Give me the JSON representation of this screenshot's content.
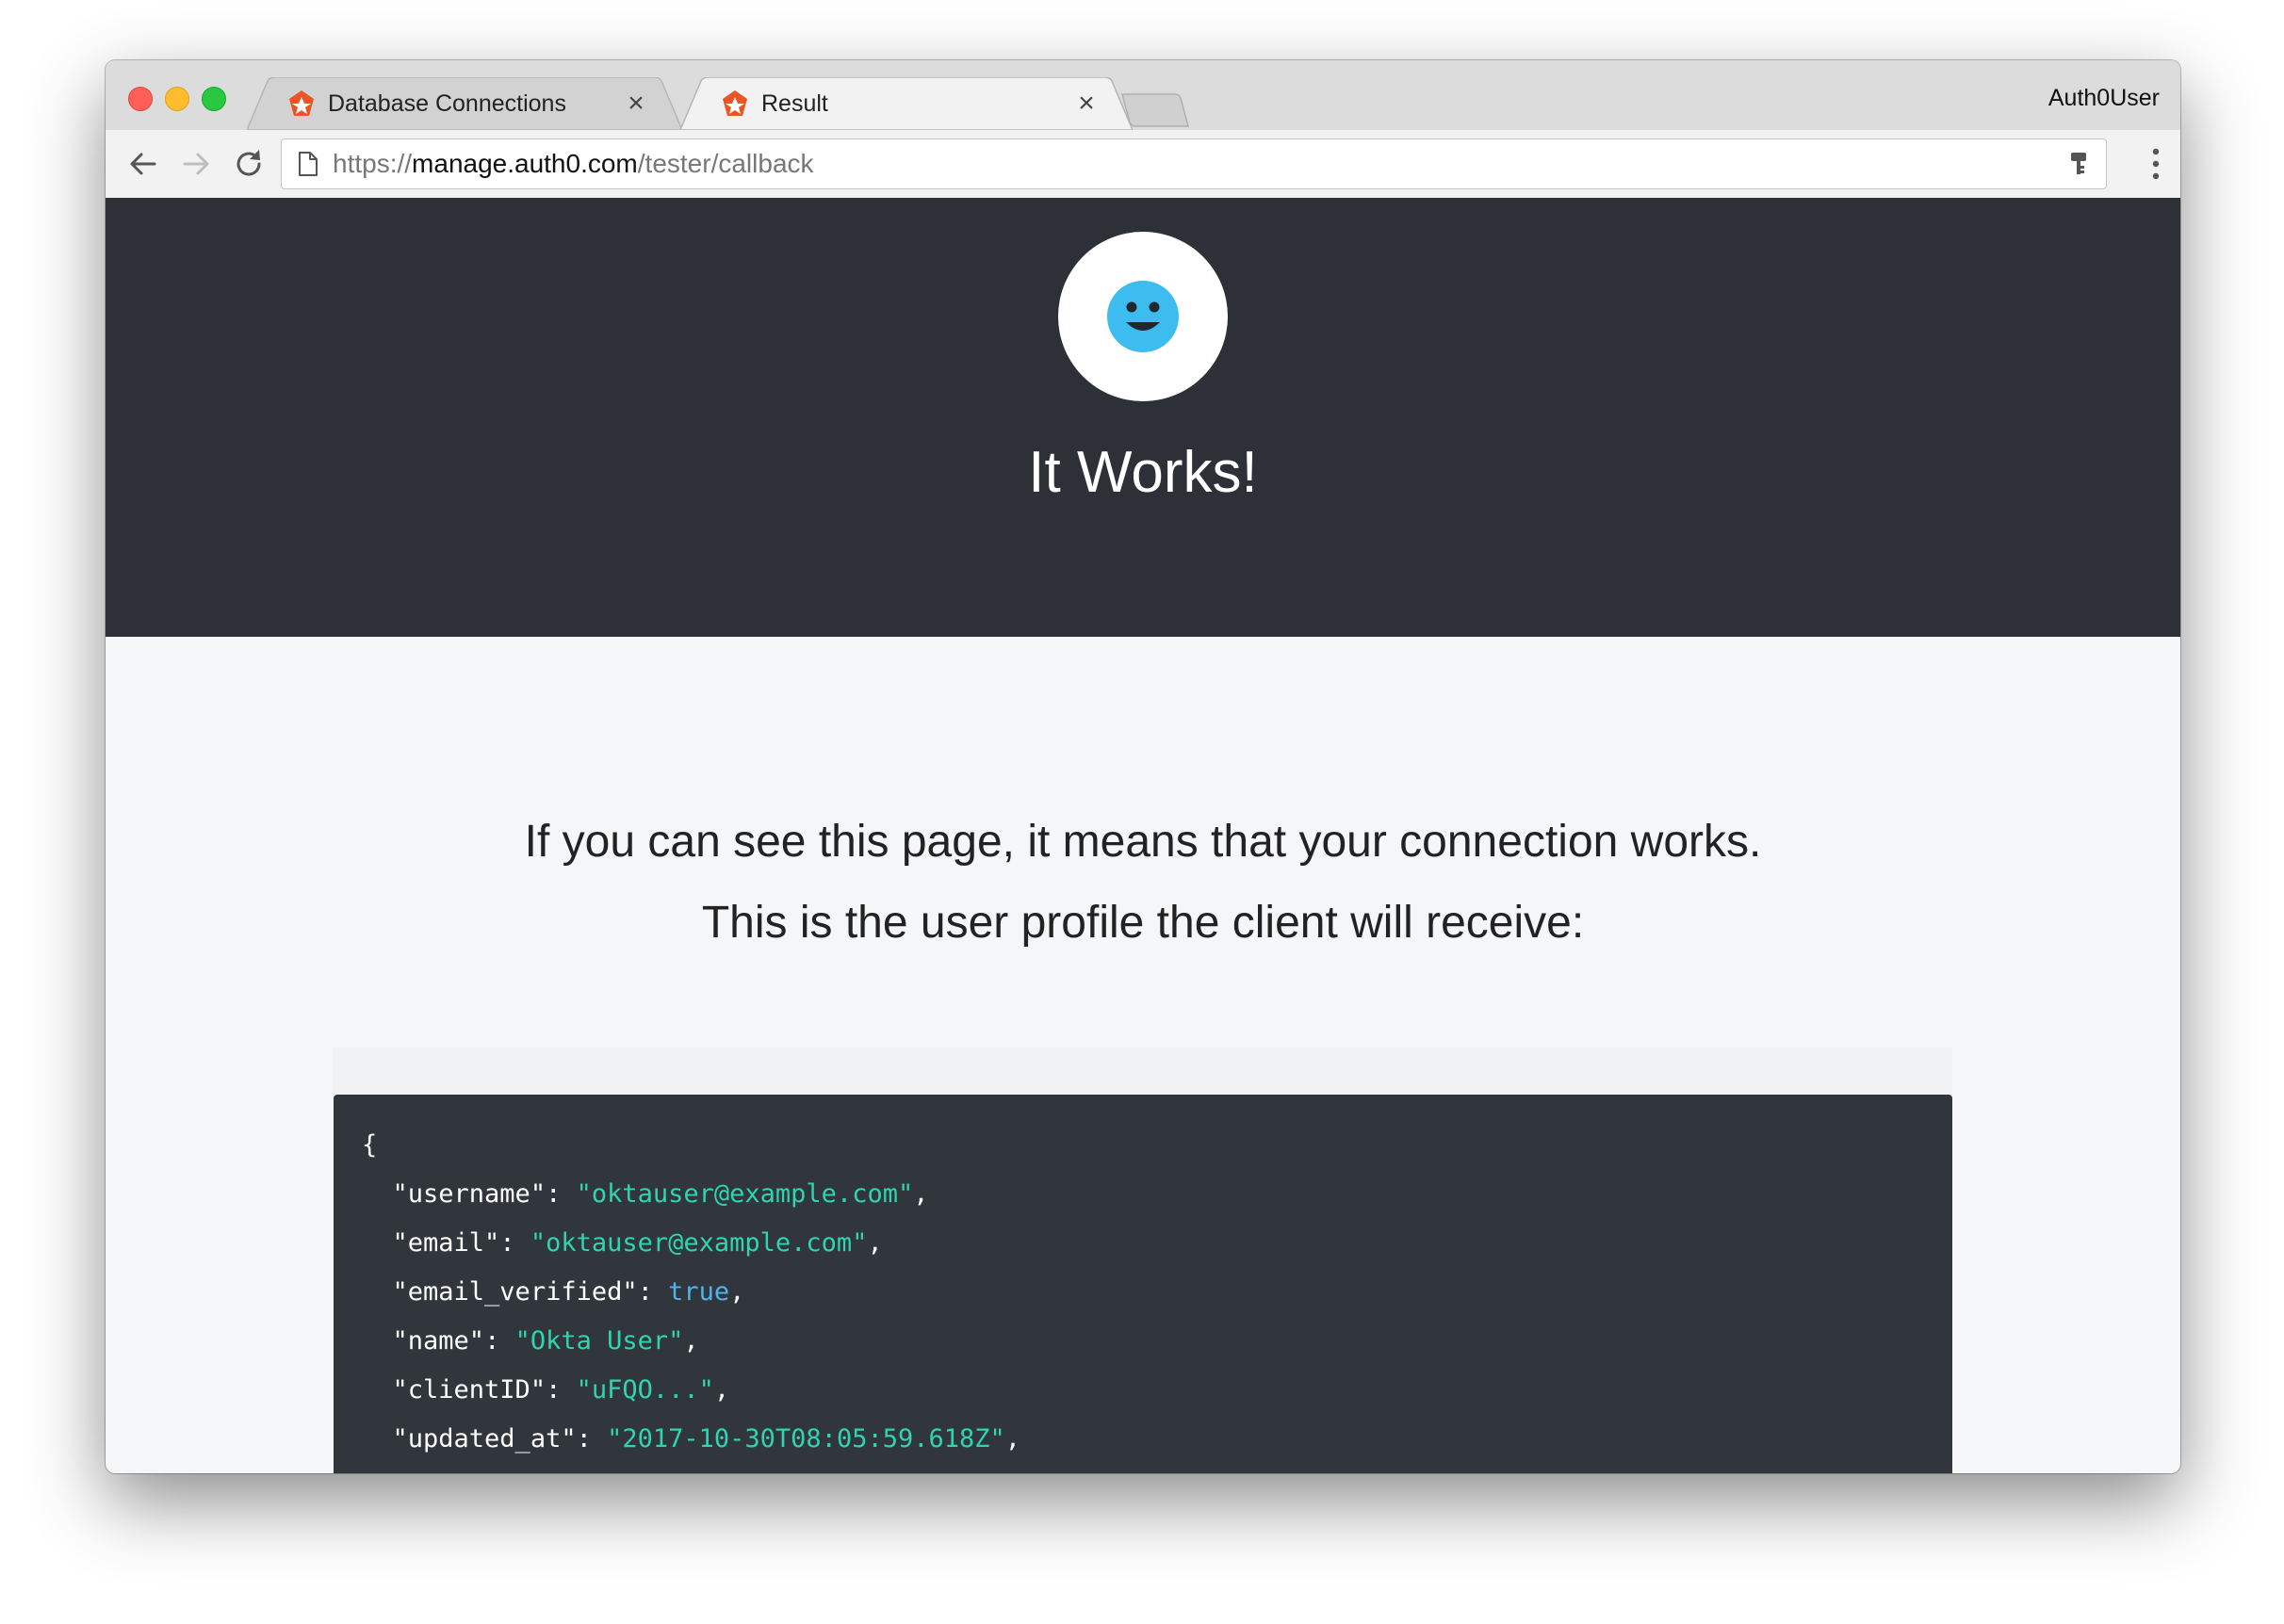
{
  "browser": {
    "tabs": [
      {
        "label": "Database Connections",
        "close": "×",
        "icon": "auth0-shield-icon"
      },
      {
        "label": "Result",
        "close": "×",
        "icon": "auth0-shield-icon"
      }
    ],
    "profile_name": "Auth0User",
    "url": {
      "scheme": "https://",
      "host": "manage.auth0.com",
      "path": "/tester/callback"
    }
  },
  "hero": {
    "title": "It Works!",
    "avatar_icon": "smiley-face-icon"
  },
  "message": {
    "line1": "If you can see this page, it means that your connection works.",
    "line2": "This is the user profile the client will receive:"
  },
  "profile_json": {
    "open_brace": "{",
    "fields": [
      {
        "key": "\"username\"",
        "value": "\"oktauser@example.com\"",
        "type": "string"
      },
      {
        "key": "\"email\"",
        "value": "\"oktauser@example.com\"",
        "type": "string"
      },
      {
        "key": "\"email_verified\"",
        "value": "true",
        "type": "boolean"
      },
      {
        "key": "\"name\"",
        "value": "\"Okta User\"",
        "type": "string"
      },
      {
        "key": "\"clientID\"",
        "value": "\"uFQO...\"",
        "type": "string"
      },
      {
        "key": "\"updated_at\"",
        "value": "\"2017-10-30T08:05:59.618Z\"",
        "type": "string"
      }
    ]
  },
  "colors": {
    "hero_bg": "#2e3038",
    "code_bg": "#30363b",
    "string_value": "#2fd4b0",
    "boolean_value": "#4fb3f0",
    "avatar_face": "#3dbcf0",
    "auth0_orange": "#eb5424"
  }
}
